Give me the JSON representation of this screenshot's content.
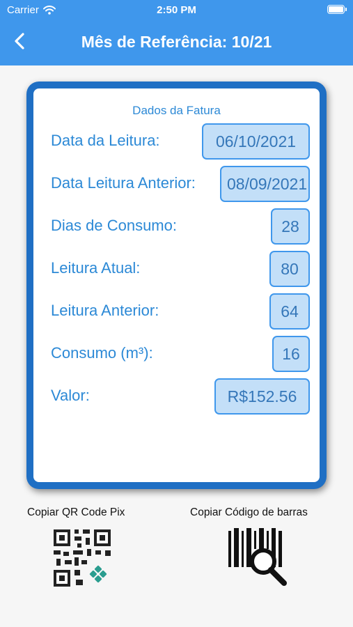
{
  "status_bar": {
    "carrier": "Carrier",
    "time": "2:50 PM"
  },
  "header": {
    "title": "Mês de Referência: 10/21",
    "back_icon": "chevron-left-icon"
  },
  "card": {
    "title": "Dados da Fatura",
    "rows": [
      {
        "label": "Data da Leitura:",
        "value": "06/10/2021"
      },
      {
        "label": "Data Leitura Anterior:",
        "value": "08/09/2021"
      },
      {
        "label": "Dias de Consumo:",
        "value": "28"
      },
      {
        "label": "Leitura Atual:",
        "value": "80"
      },
      {
        "label": "Leitura Anterior:",
        "value": "64"
      },
      {
        "label": "Consumo (m³):",
        "value": "16"
      },
      {
        "label": "Valor:",
        "value": "R$152.56"
      }
    ]
  },
  "actions": {
    "qr_label": "Copiar QR Code Pix",
    "barcode_label": "Copiar Código de barras"
  },
  "colors": {
    "header": "#3f97ec",
    "card_border": "#1f6fc4",
    "field_fill": "#c3dff8",
    "text_blue": "#2c89d6",
    "pix_green": "#2a9d8f"
  }
}
